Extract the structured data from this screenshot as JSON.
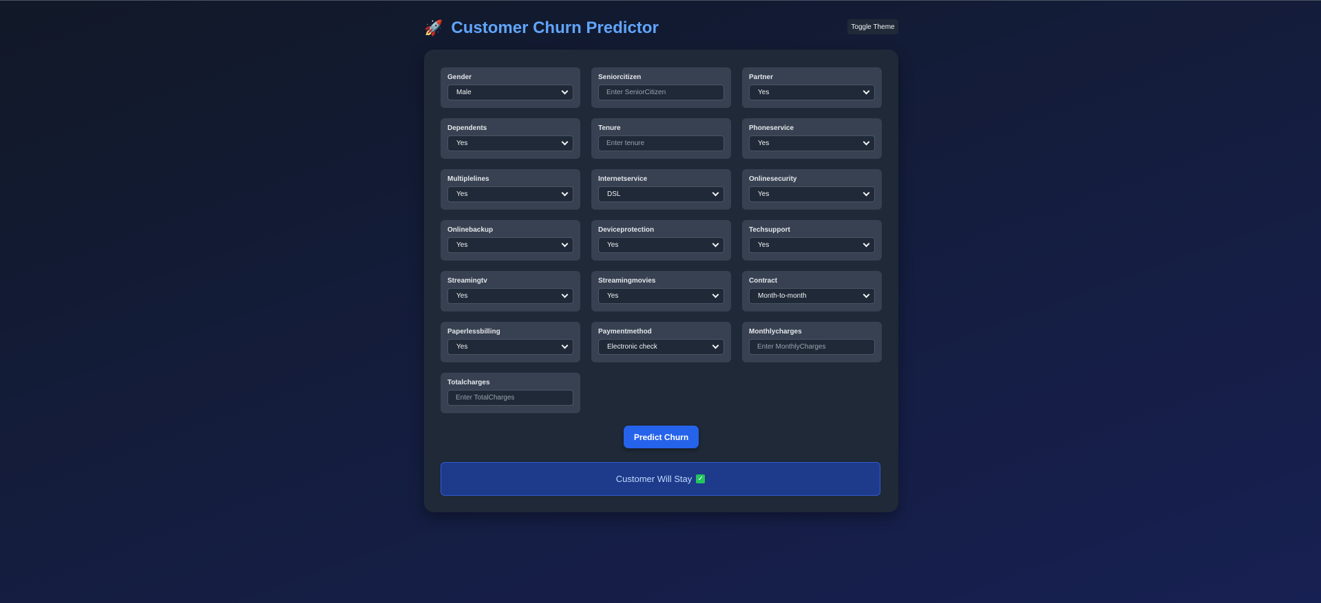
{
  "header": {
    "icon": "rocket-icon",
    "title": "Customer Churn Predictor",
    "toggle_label": "Toggle Theme"
  },
  "fields": [
    {
      "label": "Gender",
      "type": "select",
      "value": "Male"
    },
    {
      "label": "Seniorcitizen",
      "type": "input",
      "placeholder": "Enter SeniorCitizen"
    },
    {
      "label": "Partner",
      "type": "select",
      "value": "Yes"
    },
    {
      "label": "Dependents",
      "type": "select",
      "value": "Yes"
    },
    {
      "label": "Tenure",
      "type": "input",
      "placeholder": "Enter tenure"
    },
    {
      "label": "Phoneservice",
      "type": "select",
      "value": "Yes"
    },
    {
      "label": "Multiplelines",
      "type": "select",
      "value": "Yes"
    },
    {
      "label": "Internetservice",
      "type": "select",
      "value": "DSL"
    },
    {
      "label": "Onlinesecurity",
      "type": "select",
      "value": "Yes"
    },
    {
      "label": "Onlinebackup",
      "type": "select",
      "value": "Yes"
    },
    {
      "label": "Deviceprotection",
      "type": "select",
      "value": "Yes"
    },
    {
      "label": "Techsupport",
      "type": "select",
      "value": "Yes"
    },
    {
      "label": "Streamingtv",
      "type": "select",
      "value": "Yes"
    },
    {
      "label": "Streamingmovies",
      "type": "select",
      "value": "Yes"
    },
    {
      "label": "Contract",
      "type": "select",
      "value": "Month-to-month"
    },
    {
      "label": "Paperlessbilling",
      "type": "select",
      "value": "Yes"
    },
    {
      "label": "Paymentmethod",
      "type": "select",
      "value": "Electronic check"
    },
    {
      "label": "Monthlycharges",
      "type": "input",
      "placeholder": "Enter MonthlyCharges"
    },
    {
      "label": "Totalcharges",
      "type": "input",
      "placeholder": "Enter TotalCharges"
    }
  ],
  "predict_label": "Predict Churn",
  "result": {
    "text": "Customer Will Stay",
    "icon": "check-mark-icon",
    "icon_color": "#22c55e"
  },
  "colors": {
    "accent": "#2563eb",
    "title": "#60a5fa",
    "result_bg": "#1e3a8a"
  }
}
